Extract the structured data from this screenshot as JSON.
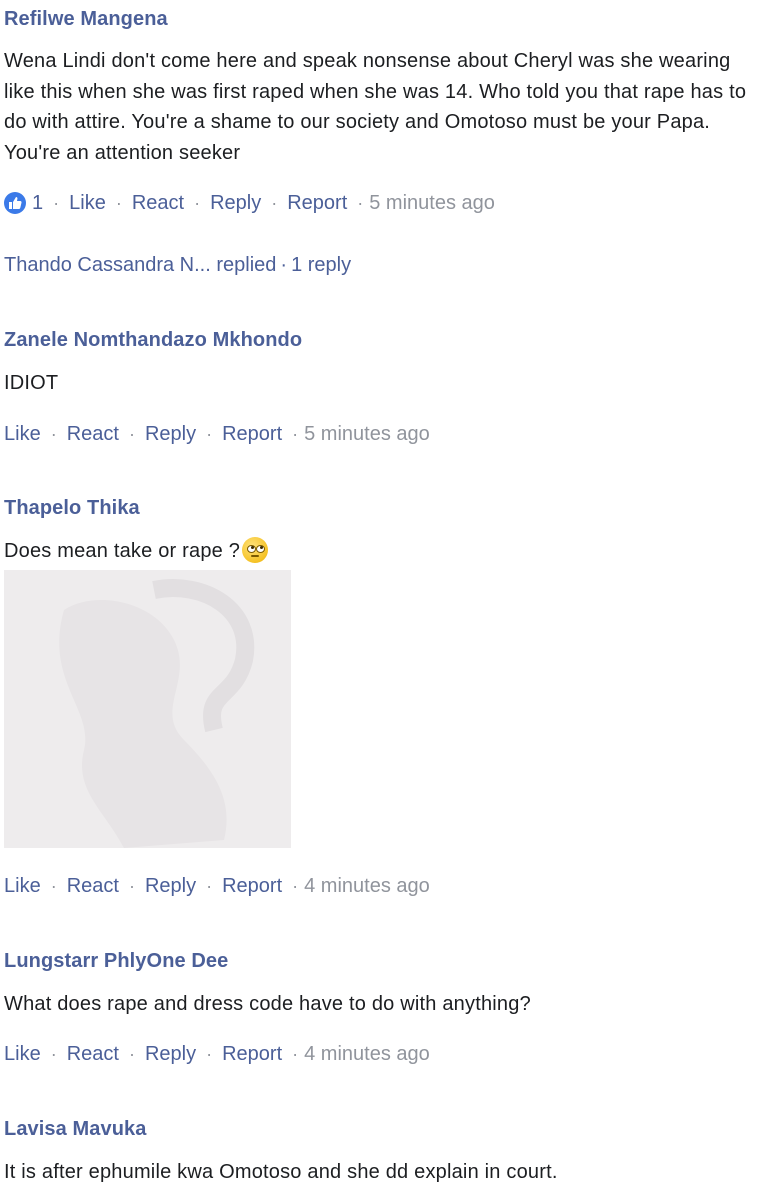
{
  "comments": [
    {
      "author": "Refilwe Mangena",
      "text": "Wena Lindi don't come here and speak nonsense about Cheryl was she wearing like this when she was first raped when she was 14. Who told you that rape has to do with attire. You're a shame to our society and Omotoso must be your Papa. You're an attention seeker",
      "reaction_count": "1",
      "time": "5 minutes ago",
      "replies": {
        "name": "Thando Cassandra N...",
        "action": "replied",
        "count": "1 reply"
      }
    },
    {
      "author": "Zanele Nomthandazo Mkhondo",
      "text": "IDIOT",
      "time": "5 minutes ago"
    },
    {
      "author": "Thapelo Thika",
      "text": "Does mean take or rape ?",
      "emoji": "face-with-rolling-eyes",
      "has_image": true,
      "time": "4 minutes ago"
    },
    {
      "author": "Lungstarr PhlyOne Dee",
      "text": "What does rape and dress code have to do with anything?",
      "time": "4 minutes ago"
    },
    {
      "author": "Lavisa Mavuka",
      "text": "It is after ephumile kwa Omotoso and she dd explain in court."
    }
  ],
  "actions": {
    "like": "Like",
    "react": "React",
    "reply": "Reply",
    "report": "Report"
  },
  "separator": "·",
  "colors": {
    "link": "#4b5f98",
    "text": "#1c1e21",
    "muted": "#90949c",
    "like_badge": "#3b7ae8"
  },
  "icons": {
    "reaction": "like-thumb-icon",
    "emoji": "rolling-eyes-emoji-icon"
  }
}
